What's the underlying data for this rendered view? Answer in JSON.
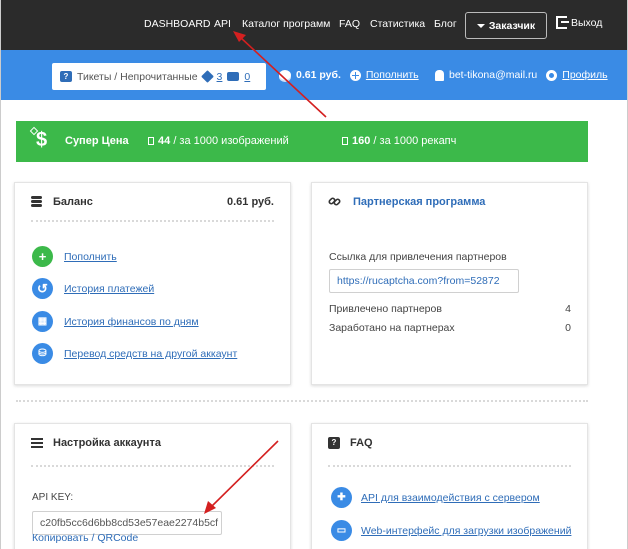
{
  "nav": {
    "items": [
      "DASHBOARD",
      "API",
      "Каталог программ",
      "FAQ",
      "Статистика",
      "Блог"
    ],
    "customer_label": "Заказчик",
    "logout_label": "Выход"
  },
  "infobar": {
    "tickets_label": "Тикеты / Непрочитанные",
    "tickets_count": "3",
    "unread_count": "0",
    "balance": "0.61 руб.",
    "topup_label": "Пополнить",
    "email": "bet-tikona@mail.ru",
    "profile_label": "Профиль"
  },
  "promo": {
    "title": "Супер Цена",
    "offer1_value": "44",
    "offer1_text": "/ за 1000 изображений",
    "offer2_value": "160",
    "offer2_text": "/ за 1000 рекапч"
  },
  "balance_card": {
    "title": "Баланс",
    "amount": "0.61 руб.",
    "links": [
      "Пополнить",
      "История платежей",
      "История финансов по дням",
      "Перевод средств на другой аккаунт"
    ]
  },
  "partner_card": {
    "title": "Партнерская программа",
    "ref_label": "Ссылка для привлечения партнеров",
    "ref_url": "https://rucaptcha.com?from=52872",
    "stats": [
      {
        "label": "Привлечено партнеров",
        "value": "4"
      },
      {
        "label": "Заработано на партнерах",
        "value": "0"
      }
    ]
  },
  "account_card": {
    "title": "Настройка аккаунта",
    "api_key_label": "API KEY:",
    "api_key": "c20fb5cc6d6bb8cd53e57eae2274b5cf",
    "copy_label": "Копировать",
    "separator": "/",
    "qr_label": "QRCode"
  },
  "faq_card": {
    "title": "FAQ",
    "links": [
      "API для взаимодействия с сервером",
      "Web-интерфейс для загрузки изображений"
    ]
  },
  "colors": {
    "nav_bg": "#2b2b2b",
    "blue": "#3a8be5",
    "green": "#3cb94a",
    "link": "#2f6db8",
    "annotation_arrow": "#d42020"
  }
}
